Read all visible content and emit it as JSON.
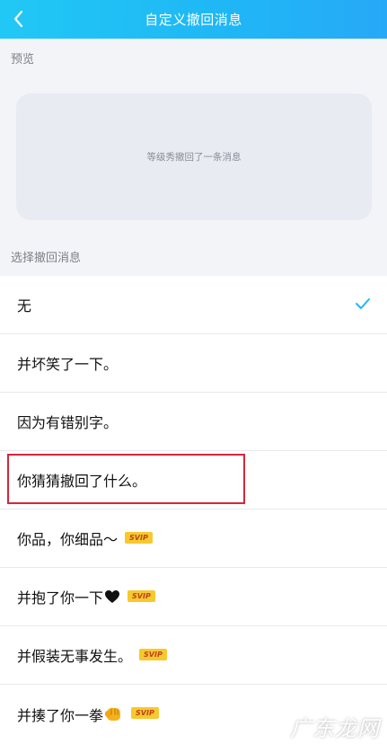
{
  "header": {
    "title": "自定义撤回消息"
  },
  "preview": {
    "section_label": "预览",
    "message": "等级秀撤回了一条消息"
  },
  "options_section": {
    "label": "选择撤回消息"
  },
  "options": [
    {
      "label": "无",
      "selected": true
    },
    {
      "label": "并坏笑了一下。"
    },
    {
      "label": "因为有错别字。"
    },
    {
      "label": "你猜猜撤回了什么。"
    },
    {
      "label": "你品，你细品～",
      "badge": "SVIP"
    },
    {
      "label": "并抱了你一下",
      "badge": "SVIP",
      "icon": "heart-icon"
    },
    {
      "label": "并假装无事发生。",
      "badge": "SVIP"
    },
    {
      "label": "并揍了你一拳",
      "badge": "SVIP",
      "icon": "fist-icon"
    }
  ],
  "watermark": {
    "text": "广东龙网"
  },
  "colors": {
    "header": "#21c8f5",
    "check": "#1fb8f5",
    "highlight": "#d8253b",
    "badge": "#f6c92e"
  }
}
